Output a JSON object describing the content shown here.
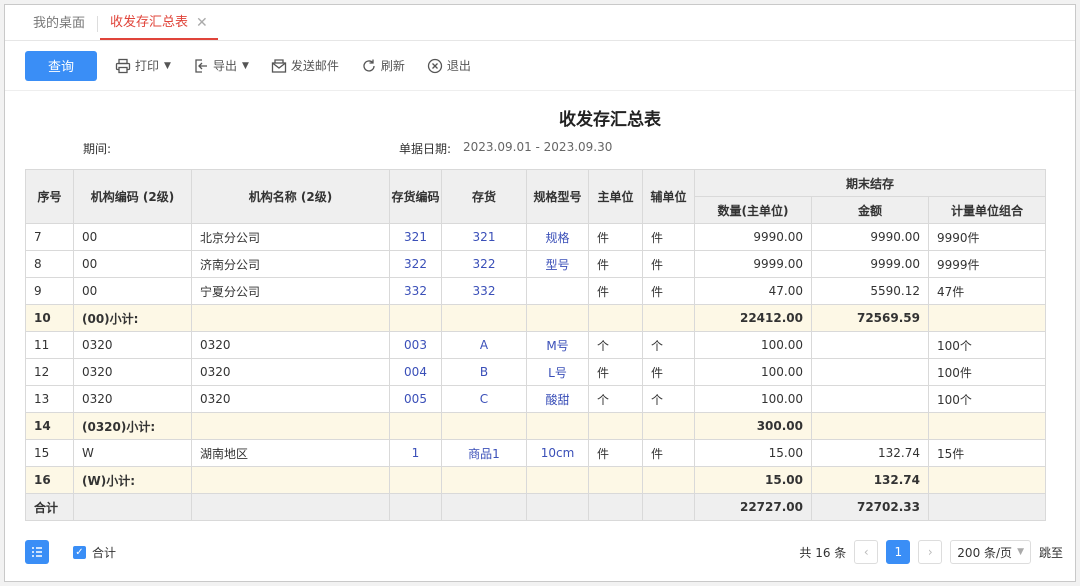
{
  "tabs": [
    {
      "label": "我的桌面",
      "active": false
    },
    {
      "label": "收发存汇总表",
      "active": true
    }
  ],
  "toolbar": {
    "query": "查询",
    "print": "打印",
    "export": "导出",
    "email": "发送邮件",
    "refresh": "刷新",
    "exit": "退出"
  },
  "report": {
    "title": "收发存汇总表",
    "period_label": "期间:",
    "date_label": "单据日期:",
    "date_value": "2023.09.01 - 2023.09.30"
  },
  "table": {
    "headers": {
      "seq": "序号",
      "org_code": "机构编码 (2级)",
      "org_name": "机构名称 (2级)",
      "inv_code": "存货编码",
      "inventory": "存货",
      "spec": "规格型号",
      "main_unit": "主单位",
      "aux_unit": "辅单位",
      "end_stock": "期末结存",
      "qty": "数量(主单位)",
      "amount": "金额",
      "unit_combo": "计量单位组合"
    },
    "rows": [
      {
        "type": "row",
        "seq": "7",
        "org_code": "00",
        "org_name": "北京分公司",
        "inv_code": "321",
        "inventory": "321",
        "spec": "规格",
        "main_unit": "件",
        "aux_unit": "件",
        "qty": "9990.00",
        "amount": "9990.00",
        "unit_combo": "9990件"
      },
      {
        "type": "row",
        "seq": "8",
        "org_code": "00",
        "org_name": "济南分公司",
        "inv_code": "322",
        "inventory": "322",
        "spec": "型号",
        "main_unit": "件",
        "aux_unit": "件",
        "qty": "9999.00",
        "amount": "9999.00",
        "unit_combo": "9999件"
      },
      {
        "type": "row",
        "seq": "9",
        "org_code": "00",
        "org_name": "宁夏分公司",
        "inv_code": "332",
        "inventory": "332",
        "spec": "",
        "main_unit": "件",
        "aux_unit": "件",
        "qty": "47.00",
        "amount": "5590.12",
        "unit_combo": "47件"
      },
      {
        "type": "sub",
        "seq": "10",
        "org_code": "(00)小计:",
        "org_name": "",
        "inv_code": "",
        "inventory": "",
        "spec": "",
        "main_unit": "",
        "aux_unit": "",
        "qty": "22412.00",
        "amount": "72569.59",
        "unit_combo": ""
      },
      {
        "type": "row",
        "seq": "11",
        "org_code": "0320",
        "org_name": "0320",
        "inv_code": "003",
        "inventory": "A",
        "spec": "M号",
        "main_unit": "个",
        "aux_unit": "个",
        "qty": "100.00",
        "amount": "",
        "unit_combo": "100个"
      },
      {
        "type": "row",
        "seq": "12",
        "org_code": "0320",
        "org_name": "0320",
        "inv_code": "004",
        "inventory": "B",
        "spec": "L号",
        "main_unit": "件",
        "aux_unit": "件",
        "qty": "100.00",
        "amount": "",
        "unit_combo": "100件"
      },
      {
        "type": "row",
        "seq": "13",
        "org_code": "0320",
        "org_name": "0320",
        "inv_code": "005",
        "inventory": "C",
        "spec": "酸甜",
        "main_unit": "个",
        "aux_unit": "个",
        "qty": "100.00",
        "amount": "",
        "unit_combo": "100个"
      },
      {
        "type": "sub",
        "seq": "14",
        "org_code": "(0320)小计:",
        "org_name": "",
        "inv_code": "",
        "inventory": "",
        "spec": "",
        "main_unit": "",
        "aux_unit": "",
        "qty": "300.00",
        "amount": "",
        "unit_combo": ""
      },
      {
        "type": "row",
        "seq": "15",
        "org_code": "W",
        "org_name": "湖南地区",
        "inv_code": "1",
        "inventory": "商品1",
        "spec": "10cm",
        "main_unit": "件",
        "aux_unit": "件",
        "qty": "15.00",
        "amount": "132.74",
        "unit_combo": "15件"
      },
      {
        "type": "sub",
        "seq": "16",
        "org_code": "(W)小计:",
        "org_name": "",
        "inv_code": "",
        "inventory": "",
        "spec": "",
        "main_unit": "",
        "aux_unit": "",
        "qty": "15.00",
        "amount": "132.74",
        "unit_combo": ""
      },
      {
        "type": "total",
        "seq": "合计",
        "org_code": "",
        "org_name": "",
        "inv_code": "",
        "inventory": "",
        "spec": "",
        "main_unit": "",
        "aux_unit": "",
        "qty": "22727.00",
        "amount": "72702.33",
        "unit_combo": ""
      }
    ]
  },
  "footer": {
    "checkbox_label": "合计",
    "total_count": "共 16 条",
    "current_page": "1",
    "page_size": "200 条/页",
    "jump": "跳至"
  },
  "colors": {
    "accent": "#3a8ef6",
    "active_tab": "#e0443a",
    "link": "#3a4fb8",
    "subtotal_bg": "#fdf8e6"
  }
}
